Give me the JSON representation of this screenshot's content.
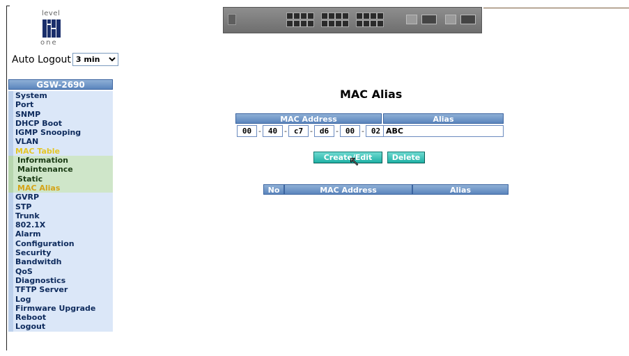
{
  "logo": {
    "top": "level",
    "bottom": "one"
  },
  "auto_logout": {
    "label": "Auto Logout",
    "value": "3 min"
  },
  "sidebar": {
    "title": "GSW-2690",
    "items": [
      {
        "label": "System"
      },
      {
        "label": "Port"
      },
      {
        "label": "SNMP"
      },
      {
        "label": "DHCP Boot"
      },
      {
        "label": "IGMP Snooping"
      },
      {
        "label": "VLAN"
      },
      {
        "label": "MAC Table"
      },
      {
        "label": "Information"
      },
      {
        "label": "Maintenance"
      },
      {
        "label": "Static"
      },
      {
        "label": "MAC Alias"
      },
      {
        "label": "GVRP"
      },
      {
        "label": "STP"
      },
      {
        "label": "Trunk"
      },
      {
        "label": "802.1X"
      },
      {
        "label": "Alarm"
      },
      {
        "label": "Configuration"
      },
      {
        "label": "Security"
      },
      {
        "label": "Bandwitdh"
      },
      {
        "label": "QoS"
      },
      {
        "label": "Diagnostics"
      },
      {
        "label": "TFTP Server"
      },
      {
        "label": "Log"
      },
      {
        "label": "Firmware Upgrade"
      },
      {
        "label": "Reboot"
      },
      {
        "label": "Logout"
      }
    ]
  },
  "main": {
    "title": "MAC Alias",
    "form": {
      "mac_header": "MAC Address",
      "alias_header": "Alias",
      "mac_octets": [
        "00",
        "40",
        "c7",
        "d6",
        "00",
        "02"
      ],
      "separator": "-",
      "alias_value": "ABC"
    },
    "buttons": {
      "create": "Create/Edit",
      "delete": "Delete"
    },
    "table": {
      "col_no": "No",
      "col_mac": "MAC Address",
      "col_alias": "Alias"
    }
  },
  "colors": {
    "header_blue": "#5b85bd",
    "button_teal": "#1fb1a5",
    "active_menu": "#e3c628"
  }
}
